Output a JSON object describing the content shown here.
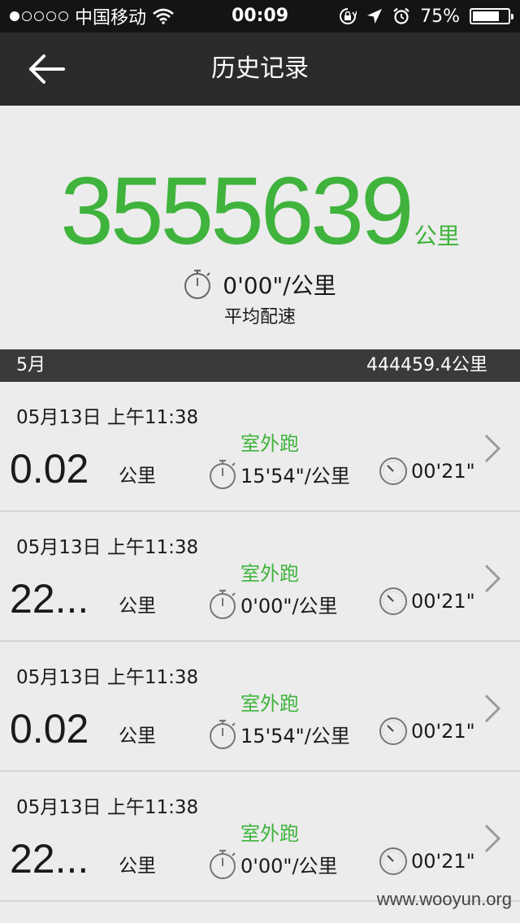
{
  "status_bar": {
    "carrier": "中国移动",
    "time": "00:09",
    "battery_text": "75%",
    "battery_level": 0.75,
    "signal_dots_filled": 1,
    "signal_dots_total": 5
  },
  "nav": {
    "title": "历史记录"
  },
  "summary": {
    "total_distance": "3555639",
    "total_unit": "公里",
    "avg_pace": "0'00\"/公里",
    "avg_pace_label": "平均配速"
  },
  "month_header": {
    "month": "5月",
    "total": "444459.4公里"
  },
  "records": [
    {
      "date": "05月13日 上午11:38",
      "distance": "0.02",
      "unit": "公里",
      "type": "室外跑",
      "pace": "15'54\"/公里",
      "duration": "00'21\""
    },
    {
      "date": "05月13日 上午11:38",
      "distance": "22...",
      "unit": "公里",
      "type": "室外跑",
      "pace": "0'00\"/公里",
      "duration": "00'21\""
    },
    {
      "date": "05月13日 上午11:38",
      "distance": "0.02",
      "unit": "公里",
      "type": "室外跑",
      "pace": "15'54\"/公里",
      "duration": "00'21\""
    },
    {
      "date": "05月13日 上午11:38",
      "distance": "22...",
      "unit": "公里",
      "type": "室外跑",
      "pace": "0'00\"/公里",
      "duration": "00'21\""
    }
  ],
  "watermark": "www.wooyun.org",
  "colors": {
    "accent_green": "#3fb33c",
    "navbar": "#2b2b2b",
    "month_bar": "#3a3a3a"
  }
}
